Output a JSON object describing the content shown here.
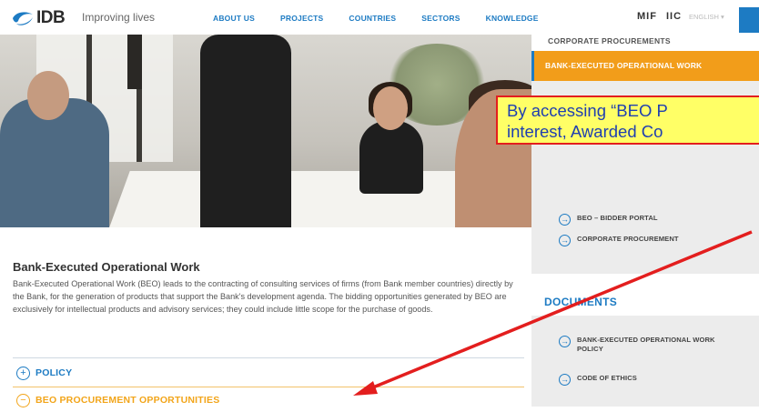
{
  "header": {
    "logo_text": "IDB",
    "tagline": "Improving lives",
    "nav": [
      "ABOUT US",
      "PROJECTS",
      "COUNTRIES",
      "SECTORS",
      "KNOWLEDGE"
    ],
    "mif": "MIF",
    "iic": "IIC",
    "language": "ENGLISH ▾"
  },
  "article": {
    "title": "Bank-Executed Operational Work",
    "body": "Bank-Executed Operational Work (BEO) leads to the contracting of consulting services of firms (from Bank member countries) directly by the Bank, for the generation of products that support the Bank's development agenda. The bidding opportunities generated by BEO are exclusively for intellectual products and advisory services; they could include little scope for the purchase of goods.",
    "accordion": [
      {
        "label": "POLICY",
        "icon": "+"
      },
      {
        "label": "BEO PROCUREMENT OPPORTUNITIES",
        "icon": "−"
      }
    ]
  },
  "sidebar": {
    "corporate_top": "CORPORATE PROCUREMENTS",
    "active_item": "BANK-EXECUTED OPERATIONAL WORK",
    "links": [
      {
        "label": "BEO – BIDDER PORTAL"
      },
      {
        "label": "CORPORATE PROCUREMENT"
      }
    ],
    "documents_heading": "DOCUMENTS",
    "documents": [
      {
        "label": "BANK-EXECUTED OPERATIONAL WORK POLICY"
      },
      {
        "label": "CODE OF ETHICS"
      }
    ]
  },
  "callout": {
    "line1": "By accessing “BEO P",
    "line2": "interest, Awarded Co"
  },
  "colors": {
    "brand_blue": "#1d7bc3",
    "accent_orange": "#f29d1a",
    "callout_bg": "#ffff66",
    "callout_border": "#e31e1e"
  }
}
